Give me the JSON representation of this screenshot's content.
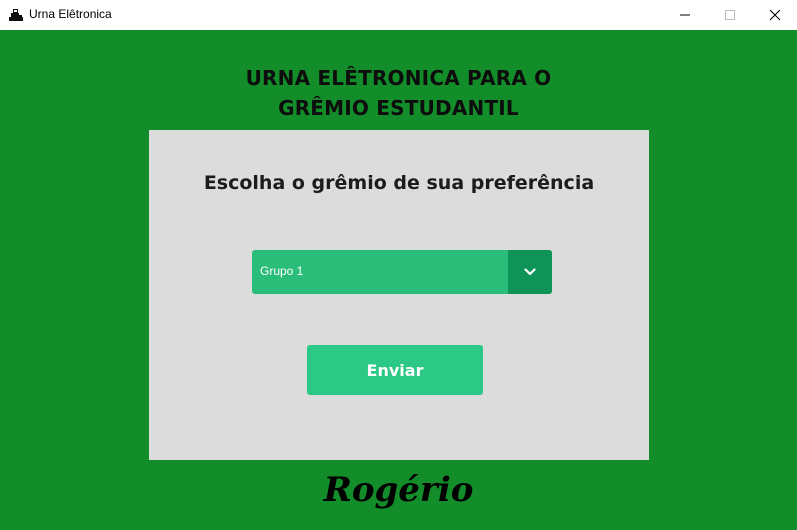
{
  "window": {
    "title": "Urna Elêtronica",
    "app_icon": "ballot-machine-icon",
    "controls": [
      "minimize-icon",
      "maximize-icon",
      "close-icon"
    ]
  },
  "header": {
    "line1": "URNA ELÊTRONICA PARA O",
    "line2": "GRÊMIO ESTUDANTIL"
  },
  "form": {
    "prompt": "Escolha o grêmio de sua preferência",
    "select": {
      "selected": "Grupo 1",
      "arrow_icon": "chevron-down-icon"
    },
    "submit_label": "Enviar"
  },
  "footer": {
    "signature": "Rogério"
  },
  "colors": {
    "background": "#138d29",
    "card": "#dcdcdc",
    "select": "#2abd7a",
    "select_arrow": "#0f9457",
    "button": "#2bc985"
  }
}
